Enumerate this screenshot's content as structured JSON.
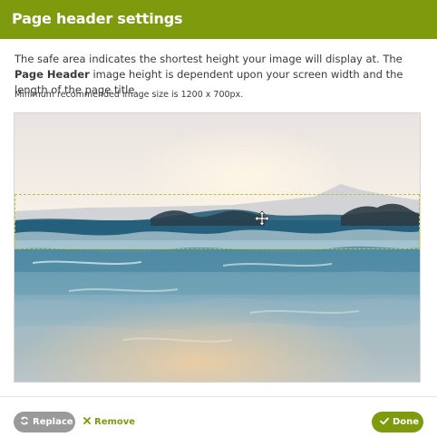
{
  "dialog": {
    "title": "Page header settings",
    "description": {
      "part1": "The safe area indicates the shortest height your image will display at. The ",
      "bold": "Page Header",
      "part2": " image height is dependent upon your screen width and the length of the page title."
    },
    "min_size_note": "Minimum recommended image size is 1200 x 700px."
  },
  "image": {
    "subject": "ocean waves at sunset"
  },
  "icons": {
    "move": "move-icon",
    "replace": "refresh-icon",
    "remove": "close-icon",
    "done": "check-icon"
  },
  "footer": {
    "replace_label": "Replace",
    "remove_label": "Remove",
    "done_label": "Done"
  },
  "colors": {
    "accent": "#7e9a0d",
    "button_gray": "#9a9a9a",
    "safe_area_border": "#b7c62a"
  }
}
